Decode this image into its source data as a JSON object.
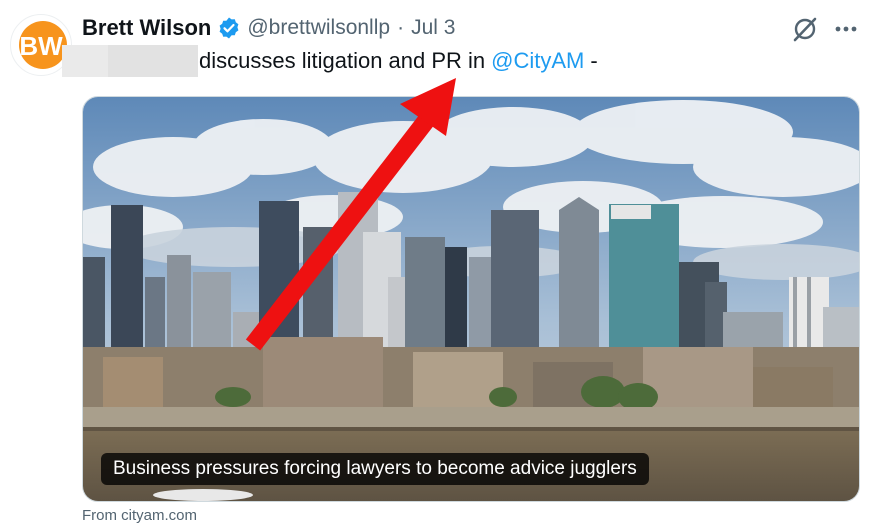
{
  "tweet": {
    "author_name": "Brett Wilson",
    "handle": "@brettwilsonllp",
    "separator": "·",
    "date": "Jul 3",
    "avatar_initials": "BW",
    "text_after_redaction": "discusses litigation and PR in",
    "mention": "@CityAM",
    "text_trailing": "-"
  },
  "card": {
    "caption": "Business pressures forcing lawyers to become advice jugglers",
    "source": "From cityam.com"
  },
  "icons": {
    "verified": "verified-badge-icon",
    "grok": "grok-icon",
    "more": "more-icon",
    "annotation": "red-arrow-annotation"
  },
  "colors": {
    "accent": "#1d9bf0",
    "secondary_text": "#536471",
    "avatar_orange": "#f7941d",
    "arrow_red": "#ee1111"
  }
}
